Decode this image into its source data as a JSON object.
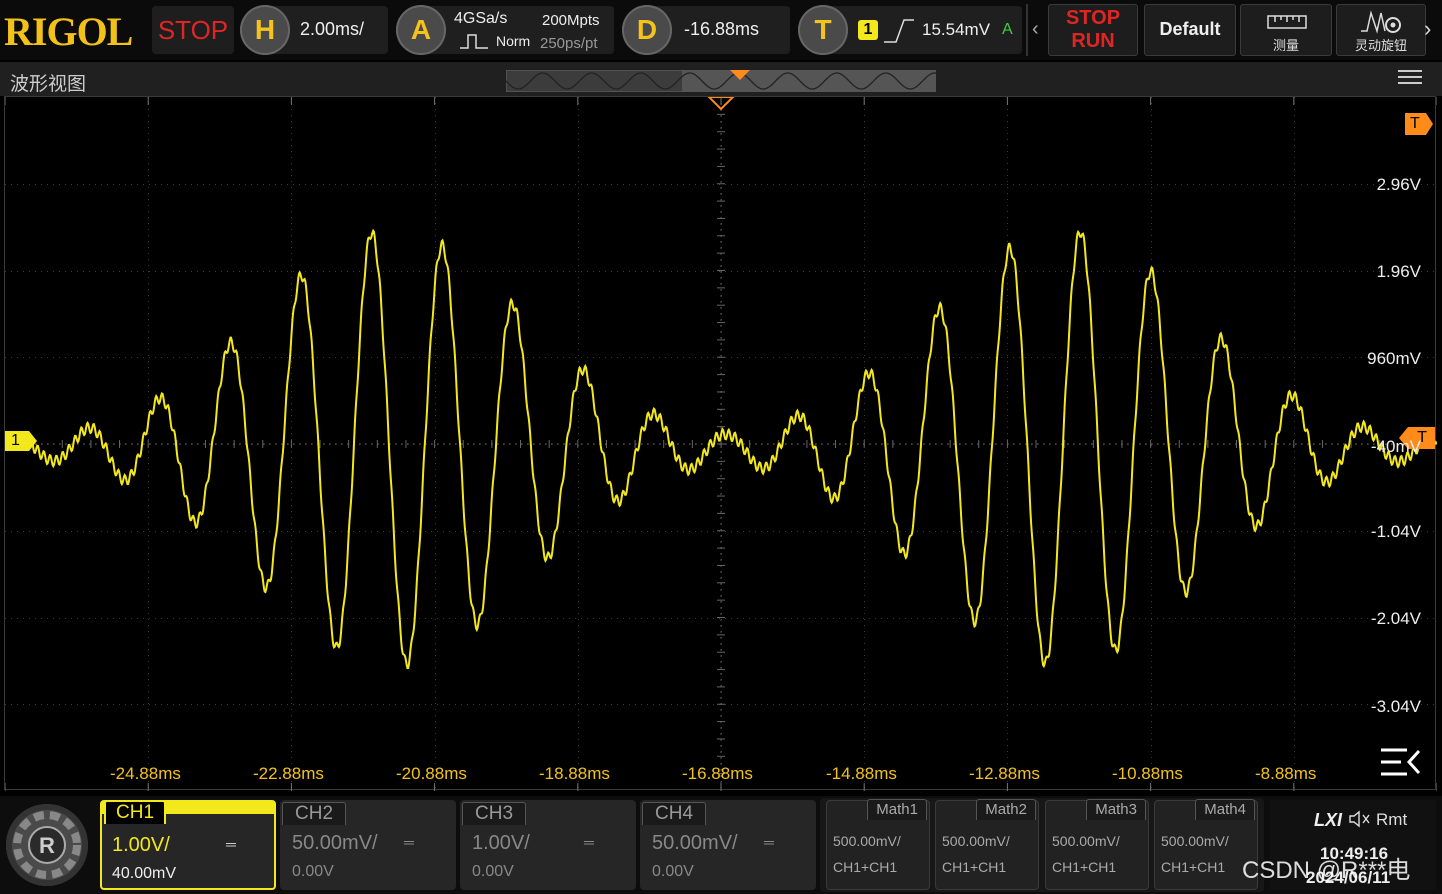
{
  "brand": "RIGOL",
  "run_state": "STOP",
  "horizontal": {
    "icon": "H",
    "timebase": "2.00ms/"
  },
  "acquire": {
    "icon": "A",
    "sample_rate": "4GSa/s",
    "memory_depth": "200Mpts",
    "mode": "Norm",
    "time_per_pt": "250ps/pt"
  },
  "delay": {
    "icon": "D",
    "value": "-16.88ms"
  },
  "trigger": {
    "icon": "T",
    "source": "1",
    "level": "15.54mV",
    "mode_letter": "A"
  },
  "buttons": {
    "stop": "STOP",
    "run": "RUN",
    "default": "Default",
    "measure": "测量",
    "knob": "灵动旋钮"
  },
  "view_title": "波形视图",
  "markers": {
    "top_trigger": "T",
    "right_trigger": "T",
    "ch1_marker": "1",
    "ch1_trig_marker": "T"
  },
  "volt_labels": [
    "2.96V",
    "1.96V",
    "960mV",
    "-40mV",
    "-1.04V",
    "-2.04V",
    "-3.04V"
  ],
  "time_labels": [
    "-24.88ms",
    "-22.88ms",
    "-20.88ms",
    "-18.88ms",
    "-16.88ms",
    "-14.88ms",
    "-12.88ms",
    "-10.88ms",
    "-8.88ms"
  ],
  "channels": [
    {
      "name": "CH1",
      "scale": "1.00V/",
      "offset": "40.00mV",
      "active": true
    },
    {
      "name": "CH2",
      "scale": "50.00mV/",
      "offset": "0.00V",
      "active": false
    },
    {
      "name": "CH3",
      "scale": "1.00V/",
      "offset": "0.00V",
      "active": false
    },
    {
      "name": "CH4",
      "scale": "50.00mV/",
      "offset": "0.00V",
      "active": false
    }
  ],
  "maths": [
    {
      "name": "Math1",
      "scale": "500.00mV/",
      "source": "CH1+CH1"
    },
    {
      "name": "Math2",
      "scale": "500.00mV/",
      "source": "CH1+CH1"
    },
    {
      "name": "Math3",
      "scale": "500.00mV/",
      "source": "CH1+CH1"
    },
    {
      "name": "Math4",
      "scale": "500.00mV/",
      "source": "CH1+CH1"
    }
  ],
  "status": {
    "lxi": "LXI",
    "remote": "Rmt",
    "time": "10:49:16",
    "date": "2024/06/11"
  },
  "watermark": "CSDN @R***电",
  "colors": {
    "ch1": "#f3e81c",
    "trigger": "#ff8c1a",
    "accent": "#f3c21a",
    "stop": "#e02525"
  }
}
